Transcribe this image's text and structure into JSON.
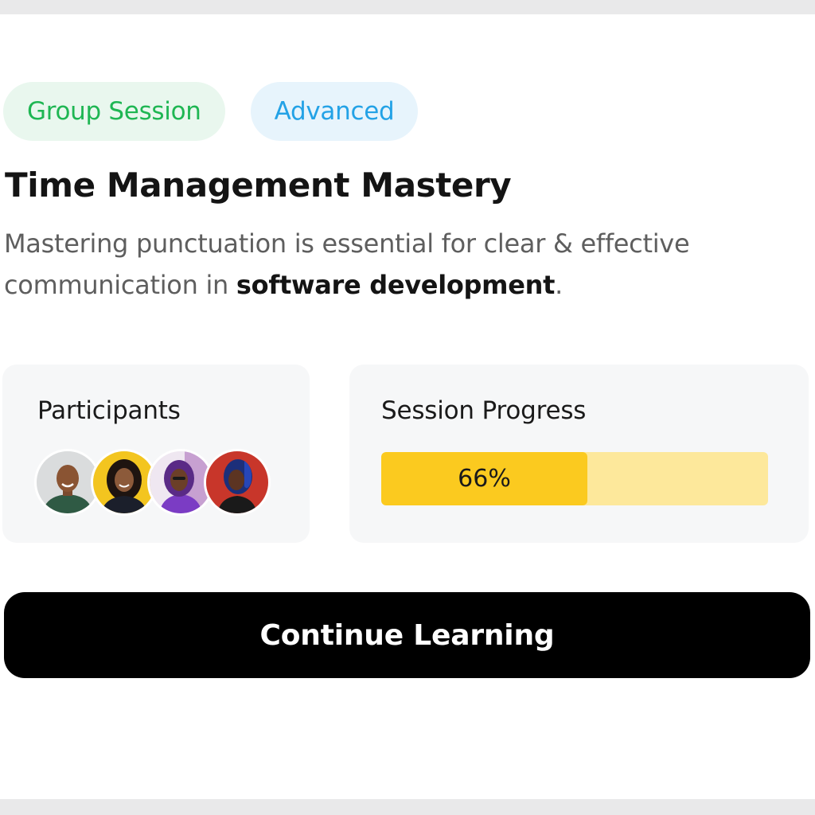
{
  "tags": {
    "group_session": "Group Session",
    "level": "Advanced"
  },
  "course": {
    "title": "Time Management Mastery",
    "description_plain": "Mastering punctuation is essential for clear & effective communication in ",
    "description_bold": "software development",
    "description_end": "."
  },
  "participants": {
    "label": "Participants",
    "avatars": [
      {
        "icon": "avatar-man-icon"
      },
      {
        "icon": "avatar-woman-yellow-icon"
      },
      {
        "icon": "avatar-woman-purple-icon"
      },
      {
        "icon": "avatar-woman-red-icon"
      }
    ]
  },
  "progress": {
    "label": "Session Progress",
    "percent": 66,
    "percent_text": "66%"
  },
  "cta": {
    "label": "Continue Learning"
  },
  "colors": {
    "green_tag_text": "#1fb653",
    "blue_tag_text": "#23a2e6",
    "progress_fill": "#fbca1f",
    "progress_track": "#fde89b",
    "cta_background": "#000000"
  }
}
